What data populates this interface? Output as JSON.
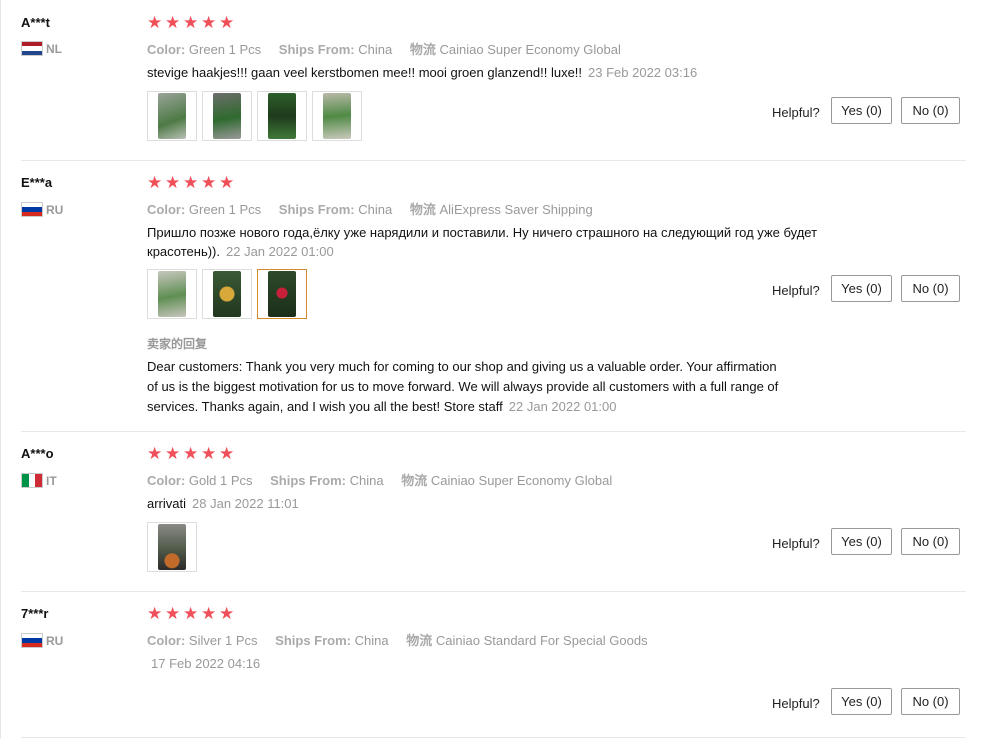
{
  "labels": {
    "color": "Color:",
    "ships_from": "Ships From:",
    "logistics": "物流",
    "helpful": "Helpful?",
    "reply_title": "卖家的回复"
  },
  "reviews": [
    {
      "user": "A***t",
      "country": "NL",
      "stars": 5,
      "color": "Green 1 Pcs",
      "ships_from": "China",
      "logistics": "Cainiao Super Economy Global",
      "text": "stevige haakjes!!! gaan veel kerstbomen mee!! mooi groen glanzend!! luxe!!",
      "date": "23 Feb 2022 03:16",
      "yes": "Yes (0)",
      "no": "No (0)"
    },
    {
      "user": "E***a",
      "country": "RU",
      "stars": 5,
      "color": "Green 1 Pcs",
      "ships_from": "China",
      "logistics": "AliExpress Saver Shipping",
      "text_line1": "Пришло позже нового года,ёлку уже нарядили и поставили. Ну ничего страшного на следующий год уже будет",
      "text_line2": "красотень)).",
      "date": "22 Jan 2022 01:00",
      "reply_line1": "Dear customers: Thank you very much for coming to our shop and giving us a valuable order. Your affirmation",
      "reply_line2": "of us is the biggest motivation for us to move forward. We will always provide all customers with a full range of",
      "reply_line3": "services. Thanks again, and I wish you all the best! Store staff",
      "reply_date": "22 Jan 2022 01:00",
      "yes": "Yes (0)",
      "no": "No (0)"
    },
    {
      "user": "A***o",
      "country": "IT",
      "stars": 5,
      "color": "Gold 1 Pcs",
      "ships_from": "China",
      "logistics": "Cainiao Super Economy Global",
      "text": "arrivati",
      "date": "28 Jan 2022 11:01",
      "yes": "Yes (0)",
      "no": "No (0)"
    },
    {
      "user": "7***r",
      "country": "RU",
      "stars": 5,
      "color": "Silver 1 Pcs",
      "ships_from": "China",
      "logistics": "Cainiao Standard For Special Goods",
      "date": "17 Feb 2022 04:16",
      "yes": "Yes (0)",
      "no": "No (0)"
    }
  ],
  "colors": {
    "star": "#f0505a",
    "selected_thumb_border": "#d28a2c",
    "muted_text": "#999999"
  }
}
